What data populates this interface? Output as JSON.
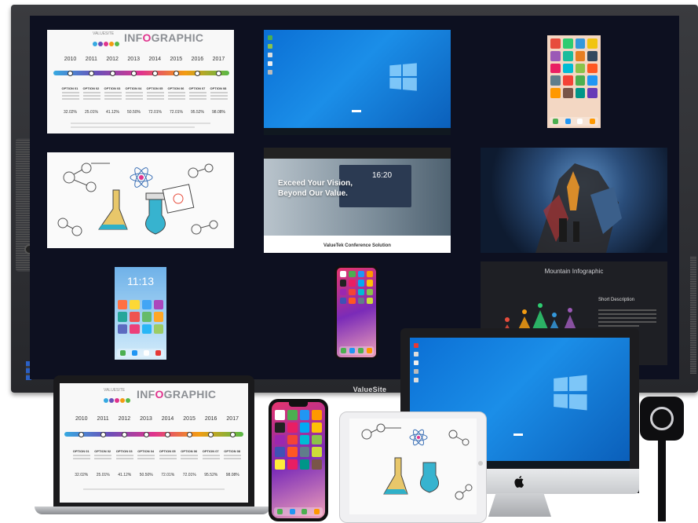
{
  "display": {
    "brand": "ValueSite"
  },
  "infographic": {
    "brand_small": "VALUESITE",
    "title_pre": "INF",
    "title_accent": "O",
    "title_post": "GRAPHIC",
    "years": [
      "2010",
      "2011",
      "2012",
      "2013",
      "2014",
      "2015",
      "2016",
      "2017"
    ],
    "option_labels": [
      "OPTION 01",
      "OPTION 02",
      "OPTION 03",
      "OPTION 04",
      "OPTION 05",
      "OPTION 06",
      "OPTION 07",
      "OPTION 08"
    ],
    "percentages": [
      "32.02%",
      "25.01%",
      "41.12%",
      "50.50%",
      "72.01%",
      "72.01%",
      "95.52%",
      "98.08%"
    ],
    "timeline_colors": [
      "#36a9e1",
      "#6a4fb8",
      "#e0338d",
      "#f39c12",
      "#58b947"
    ]
  },
  "conference": {
    "headline_line1": "Exceed Your Vision,",
    "headline_line2": "Beyond Our Value.",
    "clock": "16:20",
    "footer": "ValueTek Conference Solution"
  },
  "phones": {
    "android_clock": "11:13"
  },
  "mountain": {
    "title": "Mountain Infographic",
    "section_label": "Short Description",
    "peak_colors": [
      "#e74c3c",
      "#f39c12",
      "#2ecc71",
      "#3498db",
      "#9b59b6",
      "#e91e63"
    ]
  },
  "icons": {
    "windows_logo": "windows-logo-icon",
    "apple_logo": "apple-logo-icon",
    "atom": "atom-icon",
    "flask": "flask-icon",
    "beaker": "beaker-icon",
    "molecule": "molecule-icon",
    "dongle_button": "ring-button-icon"
  }
}
